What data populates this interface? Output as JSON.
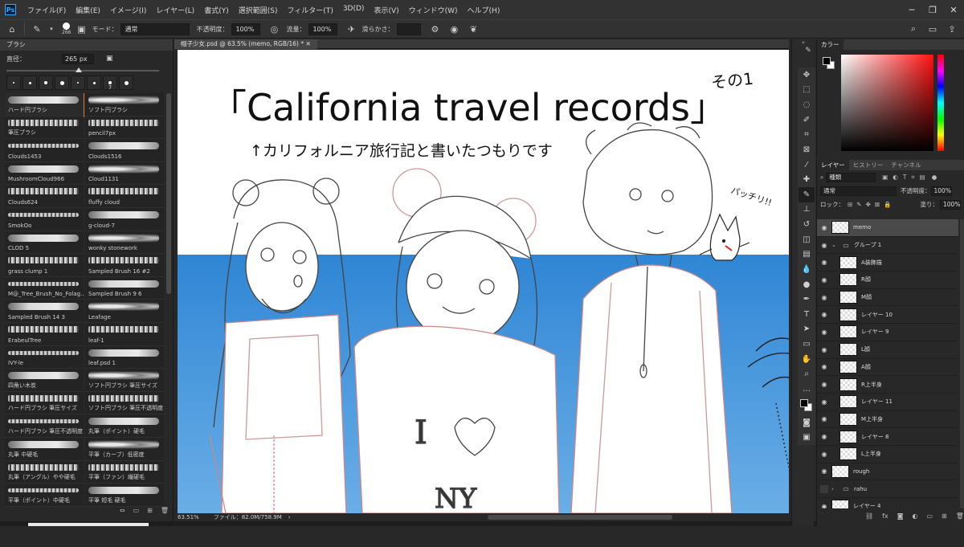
{
  "app": {
    "logo": "Ps"
  },
  "menu": [
    "ファイル(F)",
    "編集(E)",
    "イメージ(I)",
    "レイヤー(L)",
    "書式(Y)",
    "選択範囲(S)",
    "フィルター(T)",
    "3D(D)",
    "表示(V)",
    "ウィンドウ(W)",
    "ヘルプ(H)"
  ],
  "options": {
    "brush_size": "266",
    "mode_label": "モード：",
    "mode_value": "通常",
    "opacity_label": "不透明度：",
    "opacity_value": "100%",
    "flow_label": "流量：",
    "flow_value": "100%",
    "smoothing_label": "滑らかさ：",
    "smoothing_value": ""
  },
  "brush_panel": {
    "title": "ブラシ",
    "size_label": "直径：",
    "size_value": "265 px",
    "tips": [
      "",
      "",
      "",
      "",
      "",
      "",
      "7",
      ""
    ],
    "brushes": [
      "ハード円ブラシ",
      "ソフト円ブラシ",
      "筆圧ブラシ",
      "pencil7px",
      "Clouds1453",
      "Clouds1516",
      "MushroomCloud966",
      "Cloud1131",
      "Clouds624",
      "fluffy cloud",
      "SmokOo",
      "g-cloud-7",
      "CLOD 5",
      "wonky stonework",
      "grass clump 1",
      "Sampled Brush 16 #2",
      "M@_Tree_Brush_No_Folag...",
      "Sampled Brush 9 6",
      "Sampled Brush 14 3",
      "Leafage",
      "ErabeulTree",
      "leaf-1",
      "IVY-le",
      "leaf.psd 1",
      "四角い木炭",
      "ソフト円ブラシ 筆圧サイズ",
      "ハード円ブラシ 筆圧サイズ",
      "ソフト円ブラシ 筆圧不透明度",
      "ハード円ブラシ 筆圧不透明度",
      "丸筆（ポイント）硬毛",
      "丸筆 中硬毛",
      "平筆（カーブ）低密度",
      "丸筆（アングル）やや硬毛",
      "平筆（ファン）繊硬毛",
      "平筆（ポイント）中硬毛",
      "平筆 短毛 硬毛"
    ]
  },
  "document": {
    "tab_title": "帽子少女.psd @ 63.5% (memo, RGB/16) *",
    "canvas_title": "「California travel records」",
    "canvas_note_right": "その1",
    "canvas_subtitle": "↑カリフォルニア旅行記と書いたつもりです",
    "canvas_sfx": "パッチリ!!",
    "shirt_text_1": "I",
    "shirt_text_2": "NY"
  },
  "status": {
    "zoom": "63.51%",
    "file": "ファイル：82.0M/758.9M"
  },
  "color_panel": {
    "tab": "カラー"
  },
  "layer_panel": {
    "tabs": [
      "レイヤー",
      "ヒストリー",
      "チャンネル"
    ],
    "filter_kind": "種類",
    "blend_mode": "通常",
    "opacity_label": "不透明度：",
    "opacity_value": "100%",
    "lock_label": "ロック：",
    "fill_label": "塗り：",
    "fill_value": "100%",
    "layers": [
      {
        "name": "memo",
        "kind": "layer",
        "selected": true,
        "visible": true,
        "indent": false
      },
      {
        "name": "グループ 1",
        "kind": "group",
        "selected": false,
        "visible": true,
        "indent": false
      },
      {
        "name": "A装飾描",
        "kind": "layer",
        "selected": false,
        "visible": true,
        "indent": true
      },
      {
        "name": "R顔",
        "kind": "layer",
        "selected": false,
        "visible": true,
        "indent": true
      },
      {
        "name": "M顔",
        "kind": "layer",
        "selected": false,
        "visible": true,
        "indent": true
      },
      {
        "name": "レイヤー 10",
        "kind": "layer",
        "selected": false,
        "visible": true,
        "indent": true
      },
      {
        "name": "レイヤー 9",
        "kind": "layer",
        "selected": false,
        "visible": true,
        "indent": true
      },
      {
        "name": "L顔",
        "kind": "layer",
        "selected": false,
        "visible": true,
        "indent": true
      },
      {
        "name": "A顔",
        "kind": "layer",
        "selected": false,
        "visible": true,
        "indent": true
      },
      {
        "name": "R上半身",
        "kind": "layer",
        "selected": false,
        "visible": true,
        "indent": true
      },
      {
        "name": "レイヤー 11",
        "kind": "layer",
        "selected": false,
        "visible": true,
        "indent": true
      },
      {
        "name": "M上半身",
        "kind": "layer",
        "selected": false,
        "visible": true,
        "indent": true
      },
      {
        "name": "レイヤー 8",
        "kind": "layer",
        "selected": false,
        "visible": true,
        "indent": true
      },
      {
        "name": "L上半身",
        "kind": "layer",
        "selected": false,
        "visible": true,
        "indent": true
      },
      {
        "name": "rough",
        "kind": "layer",
        "selected": false,
        "visible": true,
        "indent": false
      },
      {
        "name": "rahu",
        "kind": "group",
        "selected": false,
        "visible": false,
        "indent": false
      },
      {
        "name": "レイヤー 4",
        "kind": "layer",
        "selected": false,
        "visible": true,
        "indent": false
      }
    ]
  },
  "colors": {
    "accent": "#d97a30",
    "sea": "#3b8fd8",
    "foreground": "#000000",
    "background": "#ffffff"
  }
}
